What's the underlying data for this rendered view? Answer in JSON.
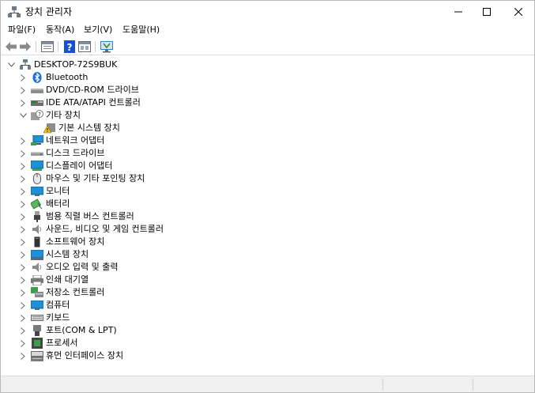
{
  "window": {
    "title": "장치 관리자"
  },
  "menubar": {
    "items": [
      "파일(F)",
      "동작(A)",
      "보기(V)",
      "도움말(H)"
    ]
  },
  "toolbar": {
    "icons": [
      "back-icon",
      "forward-icon",
      "properties-icon",
      "help-icon",
      "view-icon",
      "monitor-scan-icon"
    ]
  },
  "tree": {
    "root": {
      "label": "DESKTOP-72S9BUK",
      "icon": "computer-icon",
      "expanded": true
    },
    "categories": [
      {
        "label": "Bluetooth",
        "icon": "bluetooth-icon",
        "expanded": false
      },
      {
        "label": "DVD/CD-ROM 드라이브",
        "icon": "dvd-drive-icon",
        "expanded": false
      },
      {
        "label": "IDE ATA/ATAPI 컨트롤러",
        "icon": "ide-controller-icon",
        "expanded": false
      },
      {
        "label": "기타 장치",
        "icon": "other-devices-icon",
        "expanded": true,
        "children": [
          {
            "label": "기본 시스템 장치",
            "icon": "warning-device-icon"
          }
        ]
      },
      {
        "label": "네트워크 어댑터",
        "icon": "network-adapter-icon",
        "expanded": false
      },
      {
        "label": "디스크 드라이브",
        "icon": "disk-drive-icon",
        "expanded": false
      },
      {
        "label": "디스플레이 어댑터",
        "icon": "display-adapter-icon",
        "expanded": false
      },
      {
        "label": "마우스 및 기타 포인팅 장치",
        "icon": "mouse-icon",
        "expanded": false
      },
      {
        "label": "모니터",
        "icon": "monitor-icon",
        "expanded": false
      },
      {
        "label": "배터리",
        "icon": "battery-icon",
        "expanded": false
      },
      {
        "label": "범용 직렬 버스 컨트롤러",
        "icon": "usb-icon",
        "expanded": false
      },
      {
        "label": "사운드, 비디오 및 게임 컨트롤러",
        "icon": "sound-icon",
        "expanded": false
      },
      {
        "label": "소프트웨어 장치",
        "icon": "software-device-icon",
        "expanded": false
      },
      {
        "label": "시스템 장치",
        "icon": "system-device-icon",
        "expanded": false
      },
      {
        "label": "오디오 입력 및 출력",
        "icon": "audio-io-icon",
        "expanded": false
      },
      {
        "label": "인쇄 대기열",
        "icon": "print-queue-icon",
        "expanded": false
      },
      {
        "label": "저장소 컨트롤러",
        "icon": "storage-controller-icon",
        "expanded": false
      },
      {
        "label": "컴퓨터",
        "icon": "computer-icon",
        "expanded": false
      },
      {
        "label": "키보드",
        "icon": "keyboard-icon",
        "expanded": false
      },
      {
        "label": "포트(COM & LPT)",
        "icon": "port-icon",
        "expanded": false
      },
      {
        "label": "프로세서",
        "icon": "processor-icon",
        "expanded": false
      },
      {
        "label": "휴먼 인터페이스 장치",
        "icon": "hid-icon",
        "expanded": false
      }
    ]
  },
  "colors": {
    "monitor_blue": "#1e90d8",
    "bluetooth_blue": "#1a6fd1",
    "warning_yellow": "#f5c400",
    "help_blue": "#1a50c8"
  }
}
